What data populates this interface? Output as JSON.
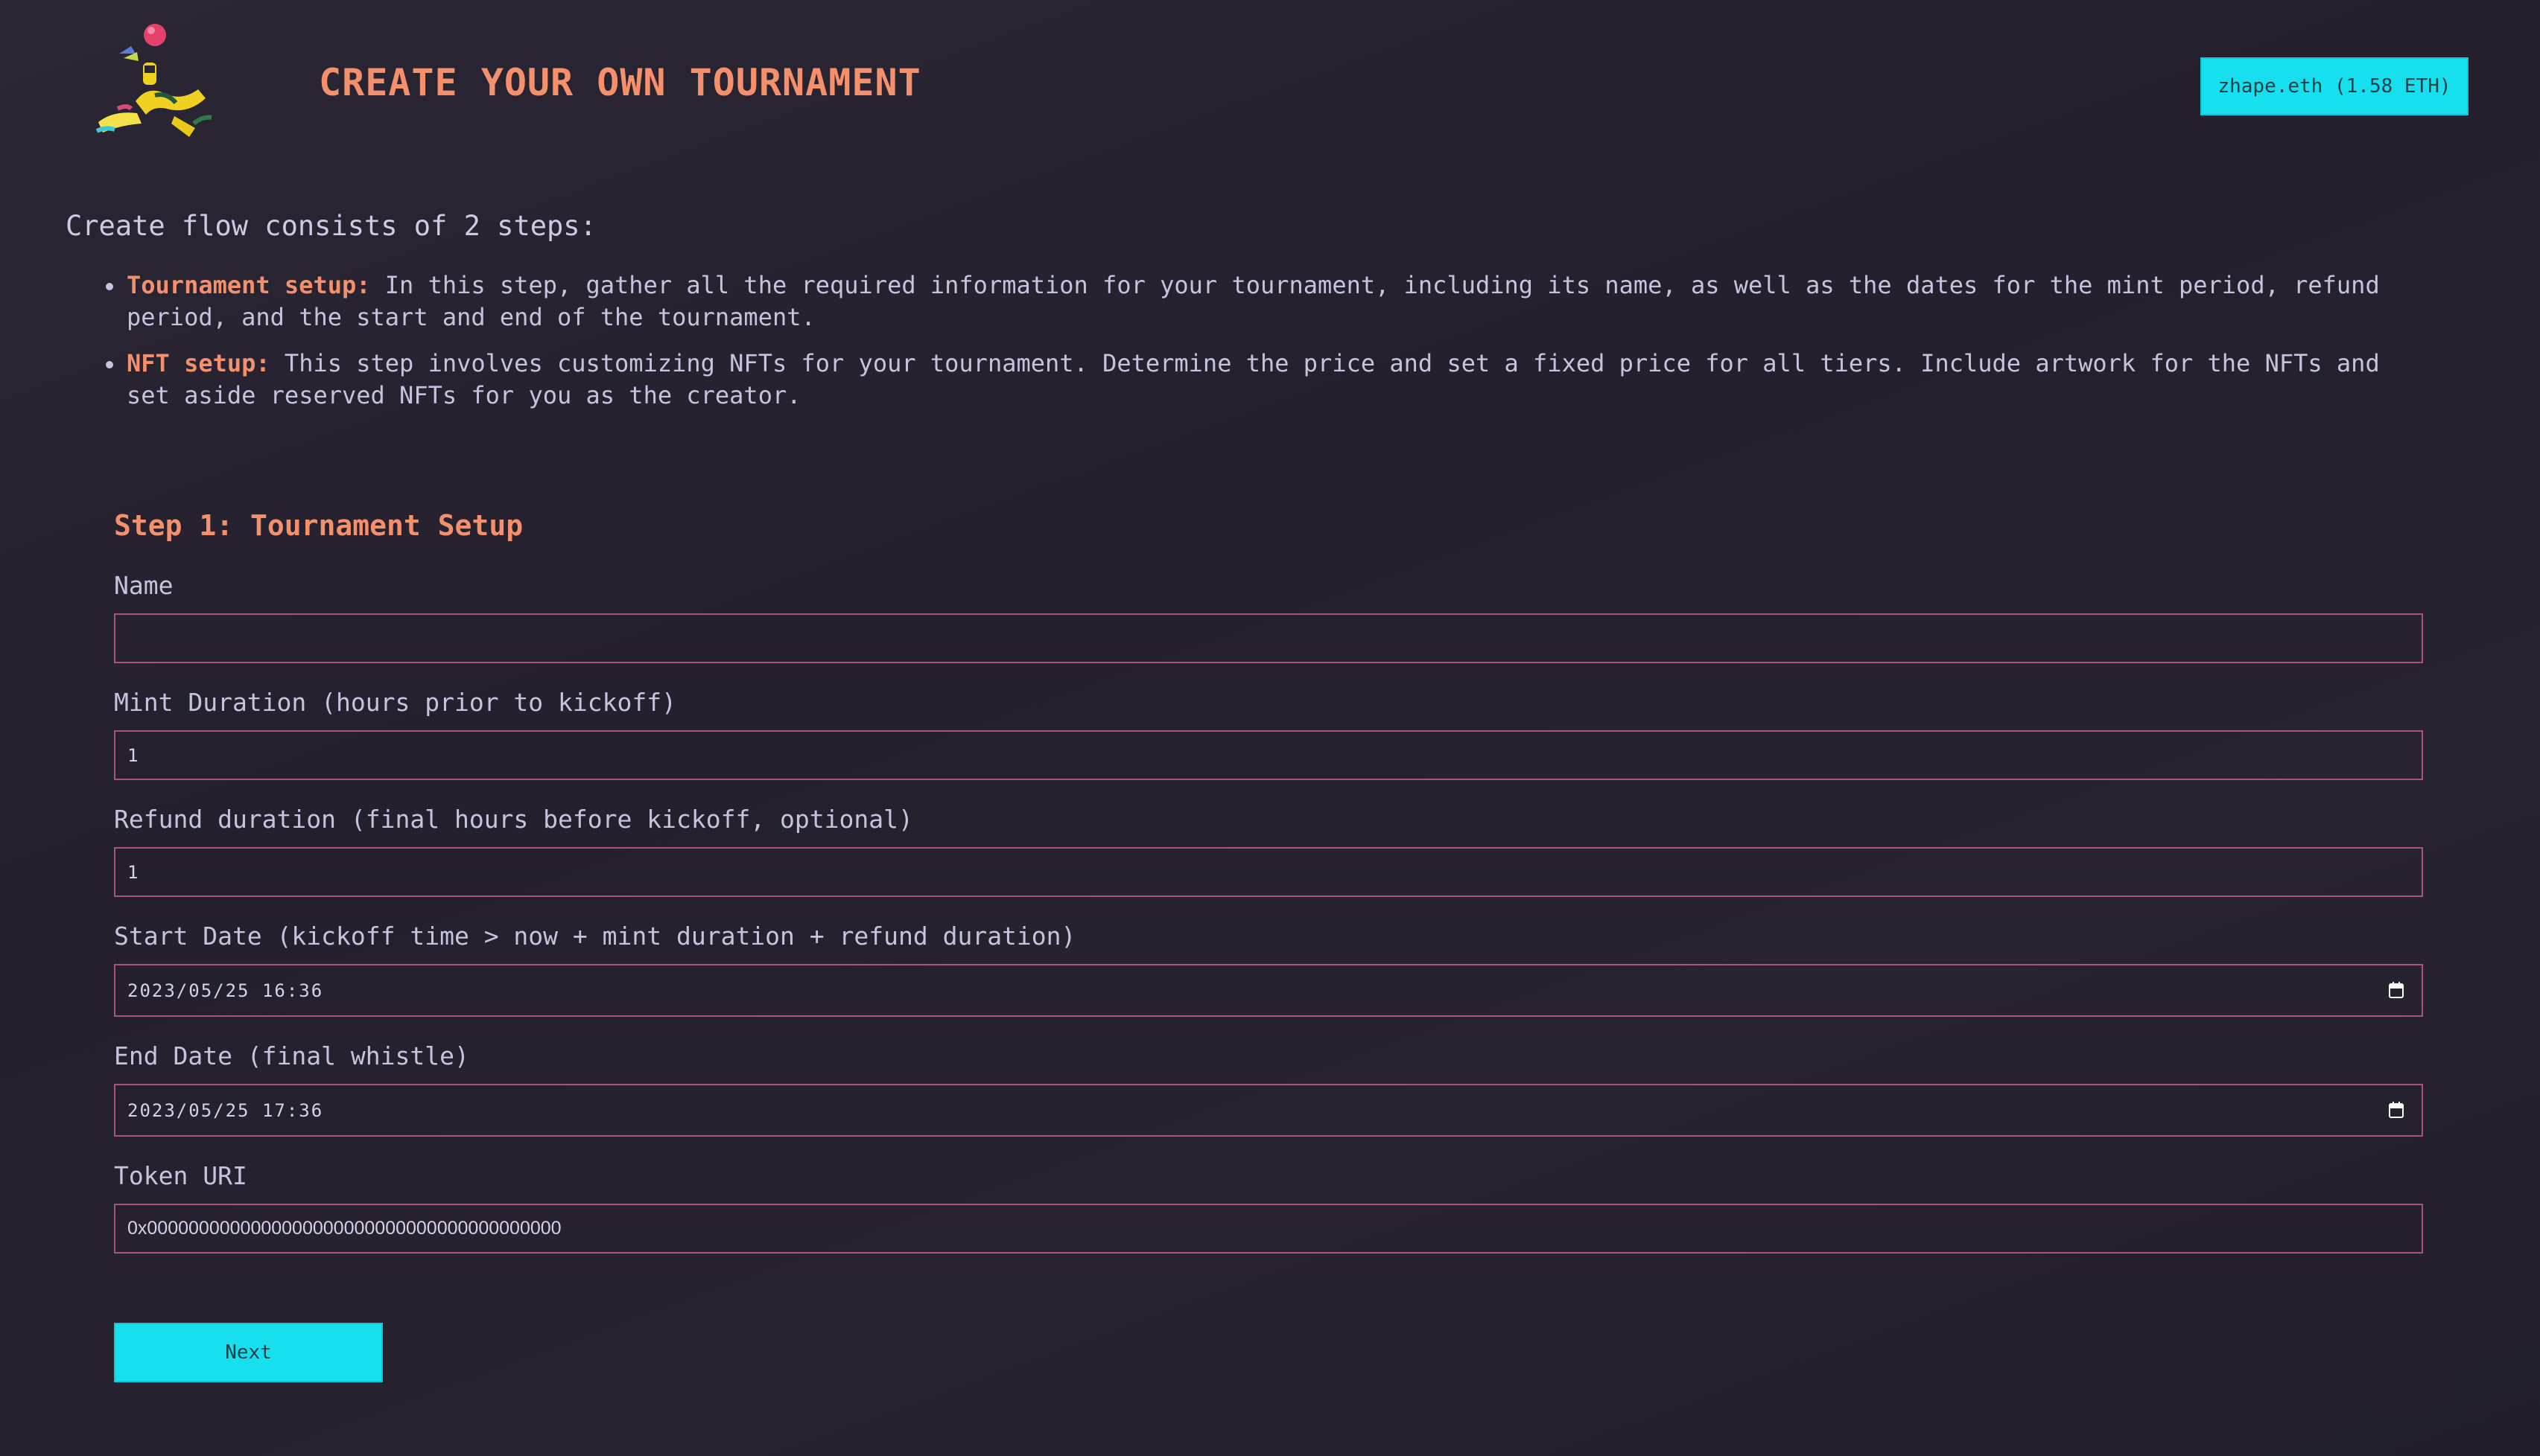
{
  "header": {
    "title": "CREATE YOUR OWN TOURNAMENT",
    "wallet_label": "zhape.eth (1.58 ETH)",
    "logo_icon": "juggling-character-logo"
  },
  "intro": {
    "text": "Create flow consists of 2 steps:",
    "steps": [
      {
        "term": "Tournament setup:",
        "description": " In this step, gather all the required information for your tournament, including its name, as well as the dates for the mint period, refund period, and the start and end of the tournament."
      },
      {
        "term": "NFT setup:",
        "description": " This step involves customizing NFTs for your tournament. Determine the price and set a fixed price for all tiers. Include artwork for the NFTs and set aside reserved NFTs for you as the creator."
      }
    ]
  },
  "form": {
    "section_title": "Step 1: Tournament Setup",
    "fields": {
      "name": {
        "label": "Name",
        "value": ""
      },
      "mint_duration": {
        "label": "Mint Duration (hours prior to kickoff)",
        "value": "1"
      },
      "refund_duration": {
        "label": "Refund duration (final hours before kickoff, optional)",
        "value": "1"
      },
      "start_date": {
        "label": "Start Date (kickoff time > now + mint duration + refund duration)",
        "value": "2023/05/25 16:36"
      },
      "end_date": {
        "label": "End Date (final whistle)",
        "value": "2023/05/25 17:36"
      },
      "token_uri": {
        "label": "Token URI",
        "value": "0x0000000000000000000000000000000000000000"
      }
    },
    "next_label": "Next"
  },
  "colors": {
    "accent": "#f4906c",
    "button": "#17dfee",
    "input_border": "#a8527c",
    "background": "#25212f"
  },
  "icons": {
    "calendar": "calendar-icon"
  }
}
